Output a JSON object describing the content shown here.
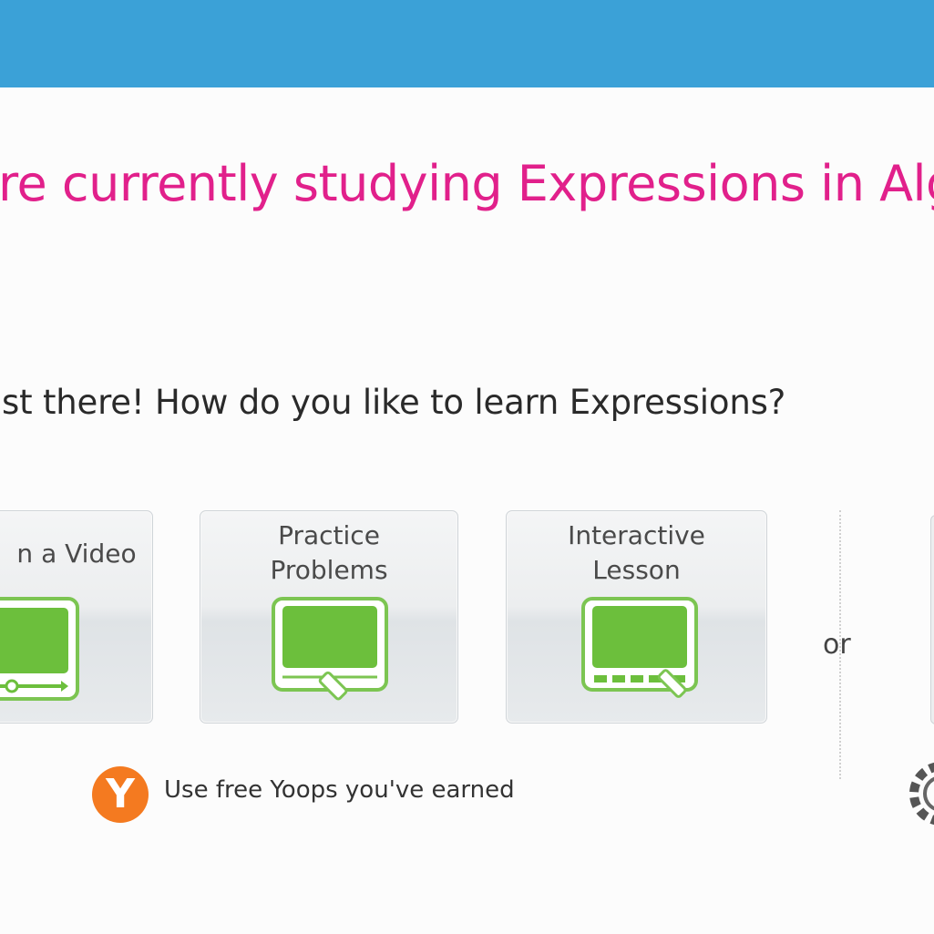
{
  "header": {
    "color": "#3ba1d7"
  },
  "headline": "re currently studying Expressions in Alg",
  "question": "st there! How do you like to learn Expressions?",
  "options": [
    {
      "label": "n a Video",
      "icon": "video-monitor-icon"
    },
    {
      "label": "Practice\nProblems",
      "icon": "practice-monitor-icon"
    },
    {
      "label": "Interactive\nLesson",
      "icon": "interactive-monitor-icon"
    }
  ],
  "or_label": "or",
  "yoops": {
    "badge": "Y",
    "text": "Use free Yoops you've earned"
  },
  "colors": {
    "headline": "#e1208b",
    "accent_green": "#6cbf3c",
    "badge_orange": "#f47a20"
  }
}
